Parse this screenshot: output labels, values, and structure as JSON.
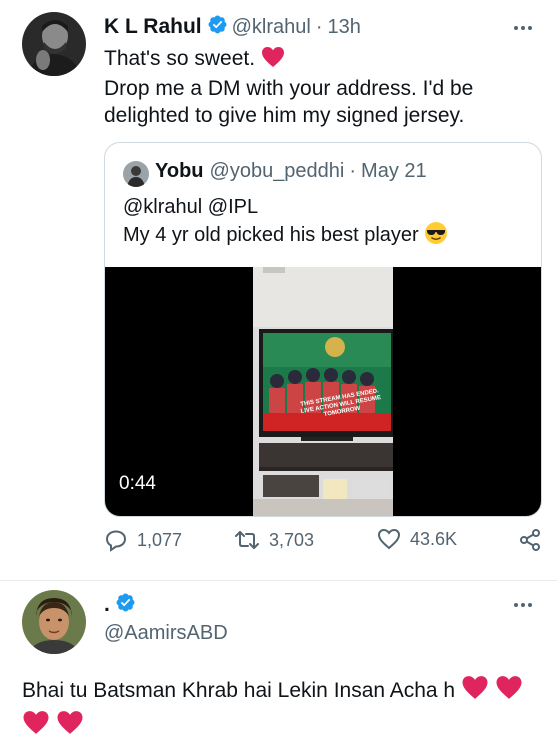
{
  "tweet": {
    "author_name": "K L Rahul",
    "author_handle": "@klrahul",
    "separator": "·",
    "time": "13h",
    "text_line1": "That's so sweet.",
    "text_line2": "Drop me a DM with your address. I'd be",
    "text_line3": "delighted to give him my signed jersey."
  },
  "quote": {
    "author_name": "Yobu",
    "author_handle": "@yobu_peddhi",
    "separator": "·",
    "date": "May 21",
    "mentions": "@klrahul @IPL",
    "text": "My 4 yr old picked his best player",
    "video_duration": "0:44",
    "tv_banner_line1": "THIS STREAM HAS ENDED.",
    "tv_banner_line2": "LIVE ACTION WILL RESUME TOMORROW"
  },
  "actions": {
    "replies": "1,077",
    "retweets": "3,703",
    "likes": "43.6K"
  },
  "reply": {
    "author_name": ".",
    "author_handle": "@AamirsABD",
    "text": "Bhai tu Batsman Khrab hai Lekin Insan Acha h"
  },
  "colors": {
    "verified": "#1d9bf0",
    "heart": "#e0245e",
    "secondary_text": "#536471",
    "border": "#cfd9de"
  },
  "icons": [
    "verified-icon",
    "heart-icon",
    "more-icon",
    "reply-icon",
    "retweet-icon",
    "like-icon",
    "share-icon",
    "sunglasses-emoji"
  ]
}
